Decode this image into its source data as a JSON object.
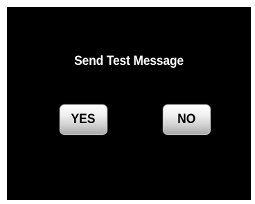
{
  "dialog": {
    "title": "Send Test Message",
    "buttons": {
      "yes_label": "YES",
      "no_label": "NO"
    }
  },
  "colors": {
    "background": "#000000",
    "title_text": "#ffffff",
    "button_text": "#000000"
  }
}
